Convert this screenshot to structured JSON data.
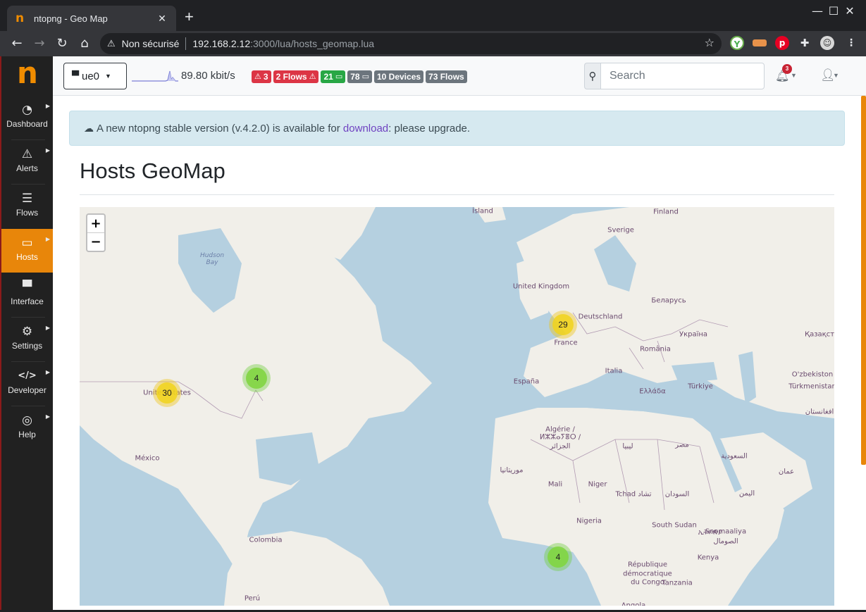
{
  "browser": {
    "tab_title": "ntopng - Geo Map",
    "tab_favicon": "n",
    "address": {
      "security_label": "Non sécurisé",
      "host": "192.168.2.12",
      "path": ":3000/lua/hosts_geomap.lua"
    },
    "window_controls": {
      "minimize": "—",
      "maximize": "☐",
      "close": "✕"
    },
    "extensions": [
      "shield-y-icon",
      "bookmark-folder-icon",
      "pinterest-icon",
      "puzzle-icon",
      "profile-avatar"
    ]
  },
  "sidebar": {
    "logo": "n",
    "items": [
      {
        "label": "Dashboard",
        "icon": "gauge-icon",
        "glyph": "◔",
        "submenu": true,
        "active": false
      },
      {
        "label": "Alerts",
        "icon": "warning-icon",
        "glyph": "⚠",
        "submenu": true,
        "active": false
      },
      {
        "label": "Flows",
        "icon": "stream-icon",
        "glyph": "☰",
        "submenu": false,
        "active": false
      },
      {
        "label": "Hosts",
        "icon": "laptop-icon",
        "glyph": "▭",
        "submenu": true,
        "active": true
      },
      {
        "label": "Interface",
        "icon": "ethernet-icon",
        "glyph": "▀",
        "submenu": false,
        "active": false
      },
      {
        "label": "Settings",
        "icon": "gear-icon",
        "glyph": "⚙",
        "submenu": true,
        "active": false
      },
      {
        "label": "Developer",
        "icon": "code-icon",
        "glyph": "</>",
        "submenu": true,
        "active": false
      },
      {
        "label": "Help",
        "icon": "life-ring-icon",
        "glyph": "◎",
        "submenu": true,
        "active": false
      }
    ]
  },
  "topnav": {
    "interface": "ue0",
    "throughput": "89.80 kbit/s",
    "badges": [
      {
        "text": "3",
        "icon": "⚠",
        "icon_pos": "before",
        "color": "#dc3545",
        "name": "alerts-badge"
      },
      {
        "text": "2 Flows",
        "icon": "⚠",
        "icon_pos": "after",
        "color": "#dc3545",
        "name": "alerted-flows-badge"
      },
      {
        "text": "21",
        "icon": "▭",
        "icon_pos": "after",
        "color": "#28a745",
        "name": "local-hosts-badge"
      },
      {
        "text": "78",
        "icon": "▭",
        "icon_pos": "after",
        "color": "#6c757d",
        "name": "remote-hosts-badge"
      },
      {
        "text": "10 Devices",
        "icon": "",
        "icon_pos": "none",
        "color": "#6c757d",
        "name": "devices-badge"
      },
      {
        "text": "73 Flows",
        "icon": "",
        "icon_pos": "none",
        "color": "#6c757d",
        "name": "flows-badge"
      }
    ],
    "search_placeholder": "Search",
    "search_value": "",
    "notifications_count": "3"
  },
  "notice": {
    "before": "A new ntopng stable version (v.4.2.0) is available for ",
    "link": "download",
    "after": ": please upgrade."
  },
  "page_title": "Hosts GeoMap",
  "map": {
    "zoom_in": "+",
    "zoom_out": "−",
    "clusters": [
      {
        "count": "30",
        "color": "yellow",
        "location": "United States (central)"
      },
      {
        "count": "4",
        "color": "green",
        "location": "United States (east coast)"
      },
      {
        "count": "29",
        "color": "yellow",
        "location": "France / United Kingdom"
      },
      {
        "count": "4",
        "color": "green",
        "location": "Gulf of Guinea"
      }
    ],
    "labels": [
      {
        "text": "Ísland"
      },
      {
        "text": "Finland"
      },
      {
        "text": "Sverige"
      },
      {
        "text": "Hudson\nBay",
        "water": true
      },
      {
        "text": "United Kingdom"
      },
      {
        "text": "Беларусь"
      },
      {
        "text": "Deutschland"
      },
      {
        "text": "Україна"
      },
      {
        "text": "Қазақст"
      },
      {
        "text": "France"
      },
      {
        "text": "România"
      },
      {
        "text": "Italia"
      },
      {
        "text": "O'zbekiston"
      },
      {
        "text": "España"
      },
      {
        "text": "Ελλάδα"
      },
      {
        "text": "Türkiye"
      },
      {
        "text": "Türkmenistan"
      },
      {
        "text": "United States"
      },
      {
        "text": "افغانستان"
      },
      {
        "text": "Algérie /"
      },
      {
        "text": "ⵍⵣⵣⴰⵢⴻⵔ /"
      },
      {
        "text": "الجزائر"
      },
      {
        "text": "ليبيا"
      },
      {
        "text": "مصر"
      },
      {
        "text": "México"
      },
      {
        "text": "السعودية"
      },
      {
        "text": "موريتانيا"
      },
      {
        "text": "عمان"
      },
      {
        "text": "Mali"
      },
      {
        "text": "Niger"
      },
      {
        "text": "Tchad تشاد"
      },
      {
        "text": "السودان"
      },
      {
        "text": "اليمن"
      },
      {
        "text": "Nigeria"
      },
      {
        "text": "South Sudan"
      },
      {
        "text": "ኢትዮጵያ"
      },
      {
        "text": "Soomaaliya"
      },
      {
        "text": "الصومال"
      },
      {
        "text": "Colombia"
      },
      {
        "text": "Kenya"
      },
      {
        "text": "République"
      },
      {
        "text": "démocratique"
      },
      {
        "text": "du Congo"
      },
      {
        "text": "Tanzania"
      },
      {
        "text": "Perú"
      },
      {
        "text": "Angola"
      }
    ]
  }
}
